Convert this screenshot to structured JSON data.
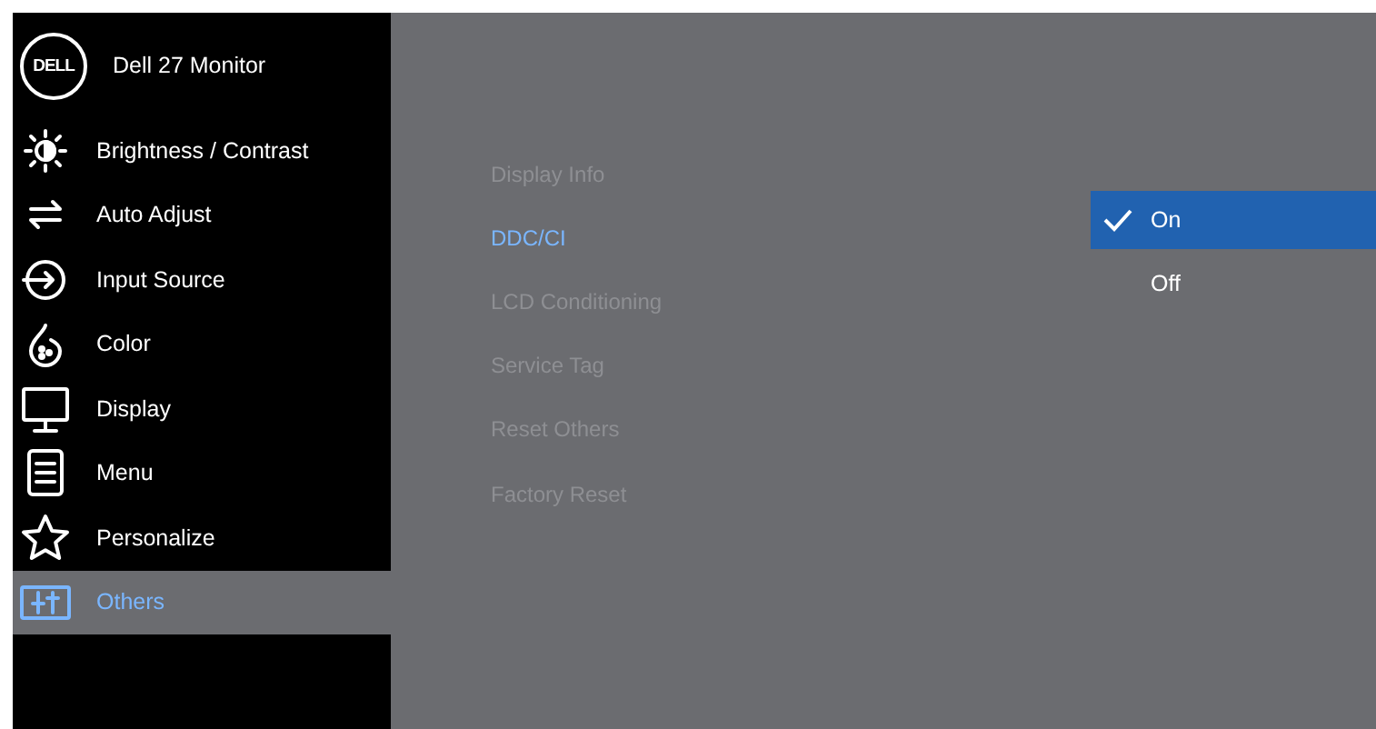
{
  "header": {
    "logo_text": "DELL",
    "title": "Dell 27 Monitor"
  },
  "menu": [
    {
      "kind": "brightness",
      "label": "Brightness / Contrast",
      "selected": false
    },
    {
      "kind": "auto",
      "label": "Auto Adjust",
      "selected": false
    },
    {
      "kind": "input",
      "label": "Input Source",
      "selected": false
    },
    {
      "kind": "color",
      "label": "Color",
      "selected": false
    },
    {
      "kind": "display",
      "label": "Display",
      "selected": false
    },
    {
      "kind": "menu",
      "label": "Menu",
      "selected": false
    },
    {
      "kind": "star",
      "label": "Personalize",
      "selected": false
    },
    {
      "kind": "others",
      "label": "Others",
      "selected": true
    }
  ],
  "submenu": [
    {
      "label": "Display Info",
      "selected": false
    },
    {
      "label": "DDC/CI",
      "selected": true
    },
    {
      "label": "LCD Conditioning",
      "selected": false
    },
    {
      "label": "Service Tag",
      "selected": false
    },
    {
      "label": "Reset Others",
      "selected": false
    },
    {
      "label": "Factory Reset",
      "selected": false
    }
  ],
  "options": [
    {
      "label": "On",
      "selected": true
    },
    {
      "label": "Off",
      "selected": false
    }
  ]
}
